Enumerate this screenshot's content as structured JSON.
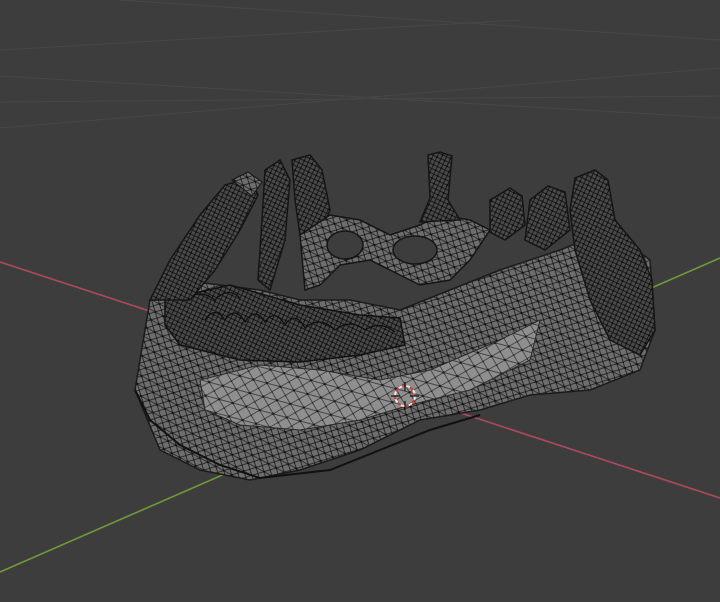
{
  "viewport": {
    "shading": "wireframe",
    "object": "jaw-mesh",
    "background_color": "#3d3d3d",
    "grid_color": "#474747",
    "x_axis_color": "#b04a58",
    "y_axis_color": "#6f9a3a",
    "mesh_fill_color": "#8a8a8a",
    "mesh_edge_color": "#1b1b1b",
    "cursor_colors": [
      "#e8e8e8",
      "#d13a3a"
    ]
  }
}
